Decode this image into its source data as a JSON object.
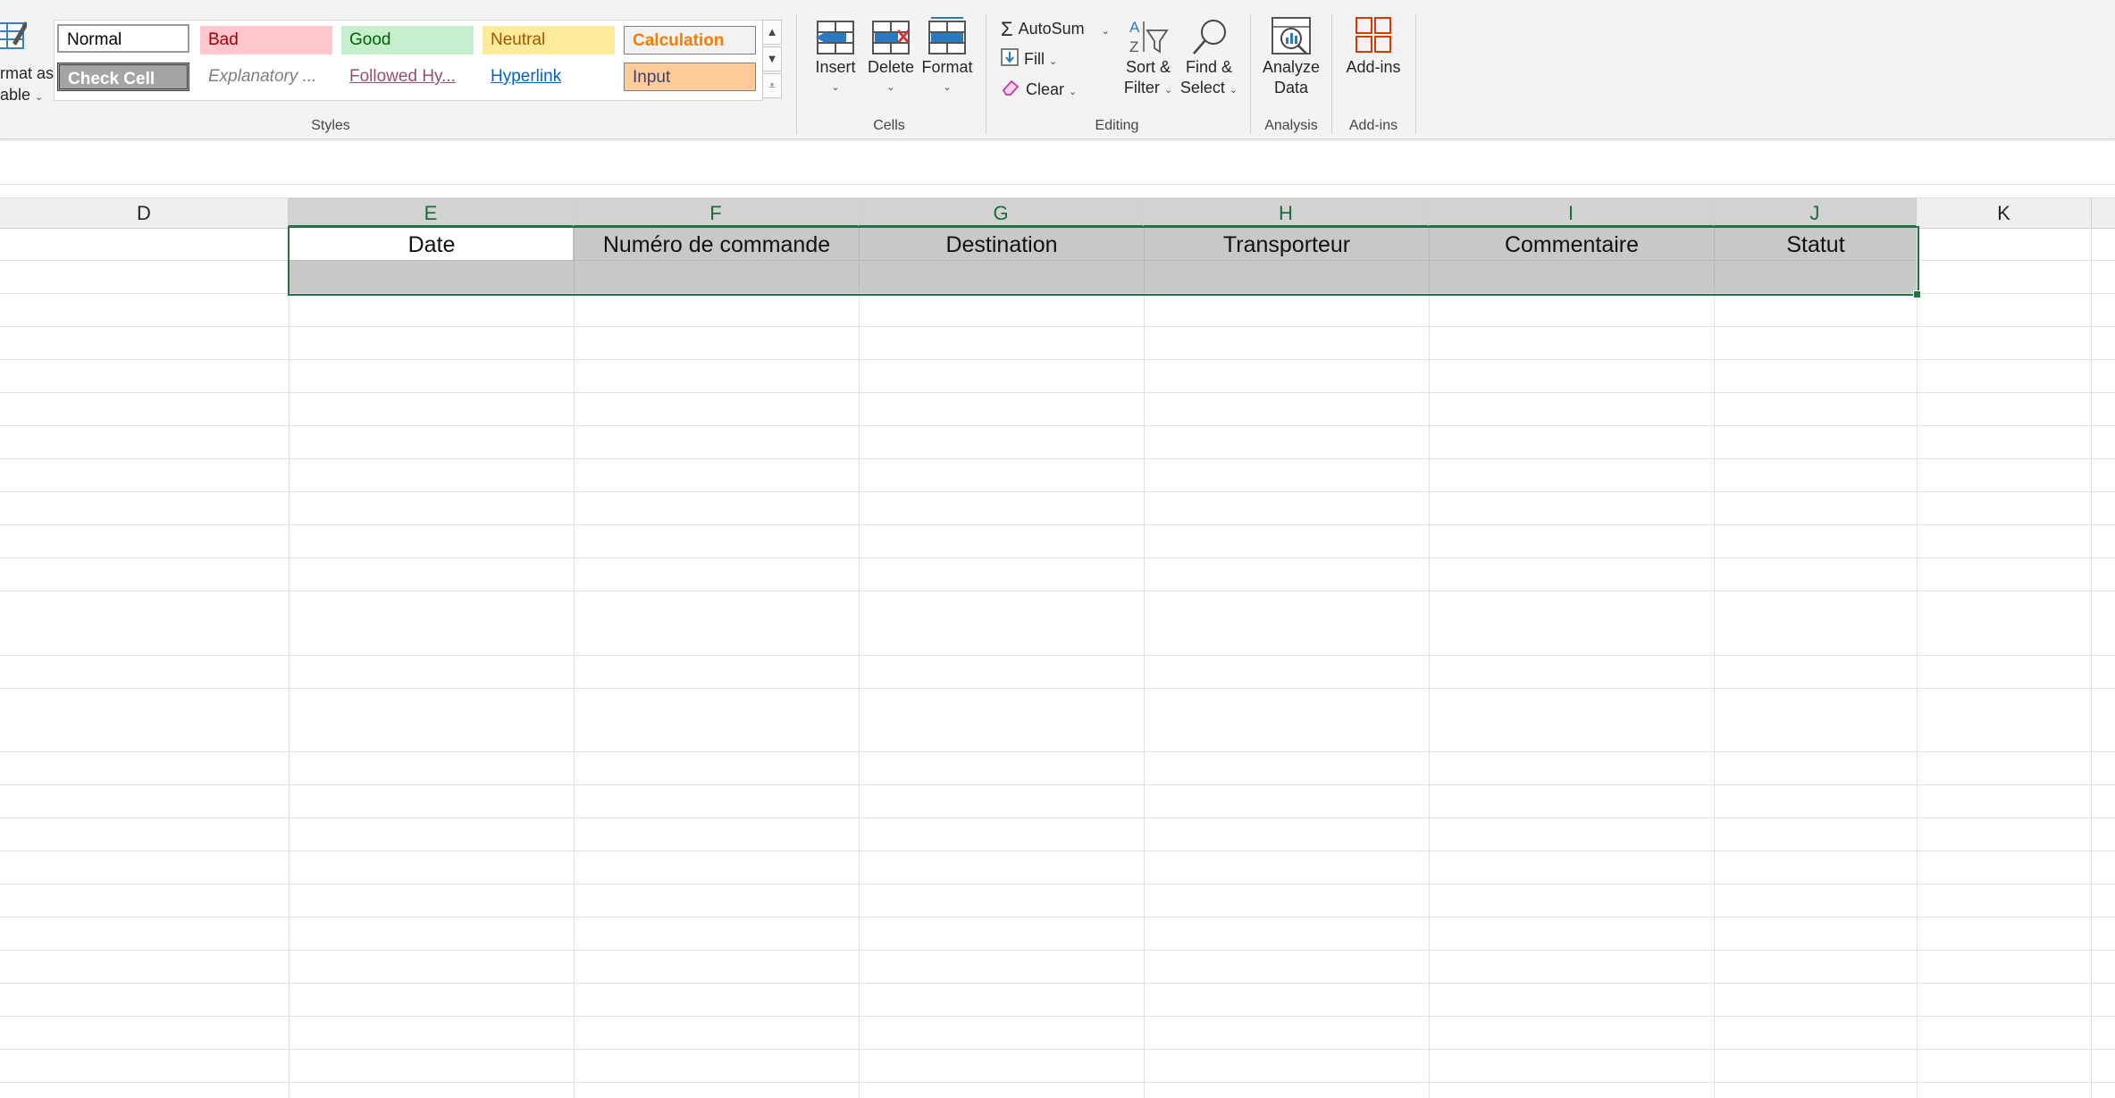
{
  "ribbon": {
    "format_as_table": {
      "line1": "rmat as",
      "line2": "able"
    },
    "styles": {
      "group_label": "Styles",
      "row1": [
        {
          "label": "Normal",
          "bg": "#ffffff",
          "fg": "#000000"
        },
        {
          "label": "Bad",
          "bg": "#ffc7ce",
          "fg": "#9c0006"
        },
        {
          "label": "Good",
          "bg": "#c6efce",
          "fg": "#006100"
        },
        {
          "label": "Neutral",
          "bg": "#ffeb9c",
          "fg": "#9c5700"
        },
        {
          "label": "Calculation",
          "bg": "#f2f2f2",
          "fg": "#fa7d00"
        }
      ],
      "row2": [
        {
          "label": "Check Cell",
          "bg": "#a5a5a5",
          "fg": "#ffffff"
        },
        {
          "label": "Explanatory ...",
          "bg": "#ffffff",
          "fg": "#7f7f7f"
        },
        {
          "label": "Followed Hy...",
          "bg": "#ffffff",
          "fg": "#954f72"
        },
        {
          "label": "Hyperlink",
          "bg": "#ffffff",
          "fg": "#0563c1"
        },
        {
          "label": "Input",
          "bg": "#ffcc99",
          "fg": "#3f3f76"
        }
      ]
    },
    "cells": {
      "group_label": "Cells",
      "insert": "Insert",
      "delete": "Delete",
      "format": "Format"
    },
    "editing": {
      "group_label": "Editing",
      "autosum": "AutoSum",
      "fill": "Fill",
      "clear": "Clear",
      "sort_filter_1": "Sort &",
      "sort_filter_2": "Filter",
      "find_select_1": "Find &",
      "find_select_2": "Select"
    },
    "analysis": {
      "group_label": "Analysis",
      "analyze_1": "Analyze",
      "analyze_2": "Data"
    },
    "addins": {
      "group_label": "Add-ins",
      "label": "Add-ins"
    }
  },
  "grid": {
    "columns": [
      "D",
      "E",
      "F",
      "G",
      "H",
      "I",
      "J",
      "K"
    ],
    "selected_columns": [
      "E",
      "F",
      "G",
      "H",
      "I",
      "J"
    ],
    "header_cells": [
      "Date",
      "Numéro de commande",
      "Destination",
      "Transporteur",
      "Commentaire",
      "Statut"
    ]
  },
  "colors": {
    "accent_green": "#217346",
    "ribbon_bg": "#f3f3f3",
    "selection_fill": "#c8c8c8"
  }
}
